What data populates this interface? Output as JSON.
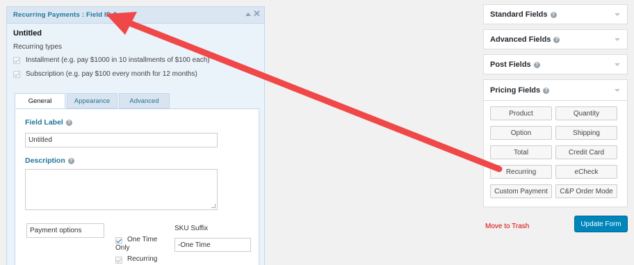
{
  "field_editor": {
    "header_title": "Recurring Payments : Field ID 2",
    "field_name": "Untitled",
    "recurring_types_label": "Recurring types",
    "options": [
      {
        "label": "Installment (e.g. pay $1000 in 10 installments of $100 each)",
        "checked": true
      },
      {
        "label": "Subscription (e.g. pay $100 every month for 12 months)",
        "checked": true
      }
    ],
    "tabs": [
      "General",
      "Appearance",
      "Advanced"
    ],
    "active_tab": "General",
    "general": {
      "field_label_heading": "Field Label",
      "field_label_value": "Untitled",
      "description_heading": "Description",
      "description_value": "",
      "payment_option_value": "Payment options",
      "one_time_label": "One Time Only",
      "one_time_checked": true,
      "recurring_label": "Recurring",
      "recurring_checked": true,
      "sku_suffix_label": "SKU Suffix",
      "sku_suffix_value": "-One Time"
    }
  },
  "sidebar": {
    "groups": [
      {
        "title": "Standard Fields"
      },
      {
        "title": "Advanced Fields"
      },
      {
        "title": "Post Fields"
      },
      {
        "title": "Pricing Fields"
      }
    ],
    "pricing_buttons": [
      "Product",
      "Quantity",
      "Option",
      "Shipping",
      "Total",
      "Credit Card",
      "Recurring",
      "eCheck",
      "Custom Payment",
      "C&P Order Mode"
    ],
    "move_to_trash": "Move to Trash",
    "update_form": "Update Form"
  },
  "colors": {
    "arrow": "#f04848",
    "accent": "#0085ba",
    "link": "#21759b",
    "trash": "#dd0000"
  }
}
